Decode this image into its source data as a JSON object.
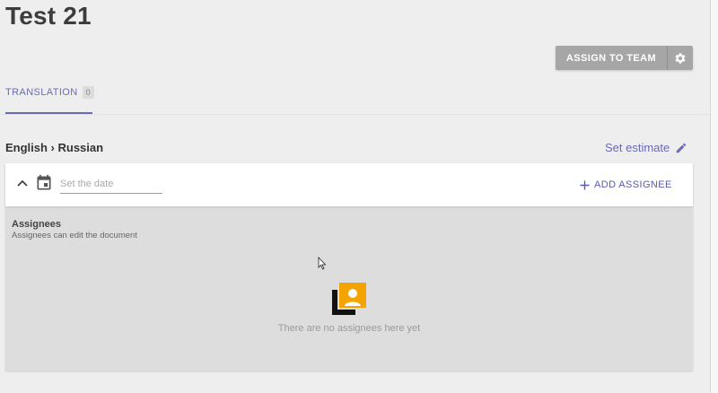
{
  "header": {
    "title": "Test 21",
    "assign_to_team_label": "ASSIGN TO TEAM",
    "settings_icon": "gear-icon"
  },
  "tabs": [
    {
      "label": "TRANSLATION",
      "count": "0",
      "active": true
    }
  ],
  "step": {
    "language_pair": "English › Russian",
    "set_estimate_label": "Set estimate",
    "date_placeholder": "Set the date",
    "add_assignee_label": "ADD ASSIGNEE",
    "assignees_title": "Assignees",
    "assignees_subtitle": "Assignees can edit the document",
    "empty_message": "There are no assignees here yet"
  },
  "colors": {
    "accent": "#6a6ab5",
    "button_grey": "#a6a6a6",
    "illustration_orange": "#f5a300"
  }
}
